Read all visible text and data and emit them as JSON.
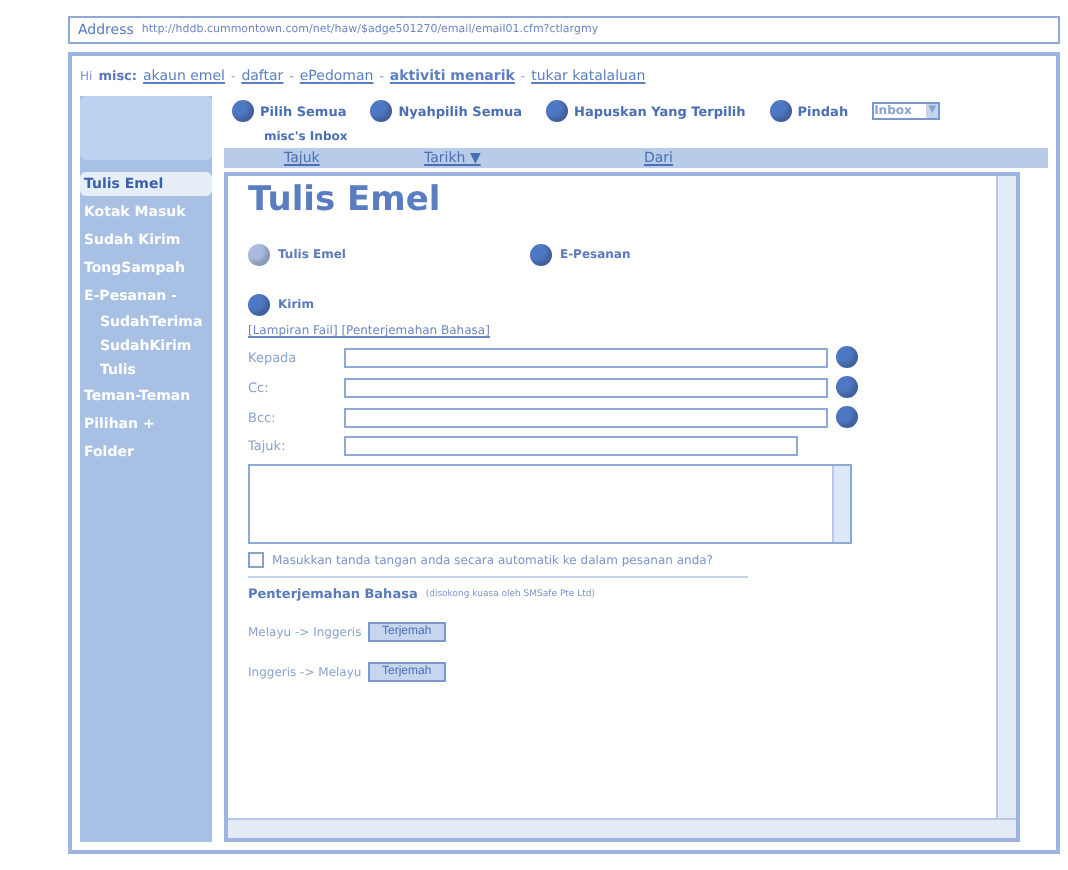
{
  "address_bar": {
    "label": "Address",
    "url": "http://hddb.cummontown.com/net/haw/$adge501270/email/email01.cfm?ctlargmy"
  },
  "nav": {
    "greeting": "Hi",
    "user": "misc:",
    "separator": "-",
    "links": [
      {
        "label": "akaun emel",
        "bold": false
      },
      {
        "label": "daftar",
        "bold": false
      },
      {
        "label": "ePedoman",
        "bold": false
      },
      {
        "label": "aktiviti menarik",
        "bold": true
      },
      {
        "label": "tukar katalaluan",
        "bold": false
      }
    ]
  },
  "toolbar": {
    "actions": [
      "Pilih Semua",
      "Nyahpilih Semua",
      "Hapuskan Yang Terpilih",
      "Pindah"
    ],
    "folder_select": "Inbox",
    "select_caret": "▼"
  },
  "inbox_title": "misc's Inbox",
  "columns": [
    "Tajuk",
    "Tarikh ▼",
    "Dari"
  ],
  "sidebar": {
    "items": [
      {
        "label": "Tulis Emel",
        "selected": true
      },
      {
        "label": "Kotak Masuk",
        "selected": false
      },
      {
        "label": "Sudah Kirim",
        "selected": false
      },
      {
        "label": "TongSampah",
        "selected": false
      },
      {
        "label": "E-Pesanan -",
        "selected": false,
        "children": [
          {
            "label": "SudahTerima",
            "selected": false
          },
          {
            "label": "SudahKirim",
            "selected": false
          },
          {
            "label": "Tulis",
            "selected": false
          }
        ]
      },
      {
        "label": "Teman-Teman",
        "selected": false
      },
      {
        "label": "Pilihan +",
        "selected": false
      },
      {
        "label": "Folder",
        "selected": false
      }
    ]
  },
  "compose": {
    "title": "Tulis Emel",
    "tabs": [
      "Tulis Emel",
      "E-Pesanan"
    ],
    "send": "Kirim",
    "links": "[Lampiran Fail] [Penterjemahan Bahasa]",
    "fields": [
      {
        "label": "Kepada",
        "address_book": true
      },
      {
        "label": "Cc:",
        "address_book": true
      },
      {
        "label": "Bcc:",
        "address_book": true
      },
      {
        "label": "Tajuk:",
        "address_book": false
      }
    ],
    "signature": {
      "label": "Masukkan tanda tangan anda secara automatik ke dalam pesanan anda?",
      "checked": false
    },
    "translation": {
      "title": "Penterjemahan Bahasa",
      "note": "(disokong kuasa oleh SMSafe Pte Ltd)",
      "rows": [
        {
          "label": "Melayu -> Inggeris",
          "button": "Terjemah"
        },
        {
          "label": "Inggeris -> Melayu",
          "button": "Terjemah"
        }
      ]
    }
  }
}
